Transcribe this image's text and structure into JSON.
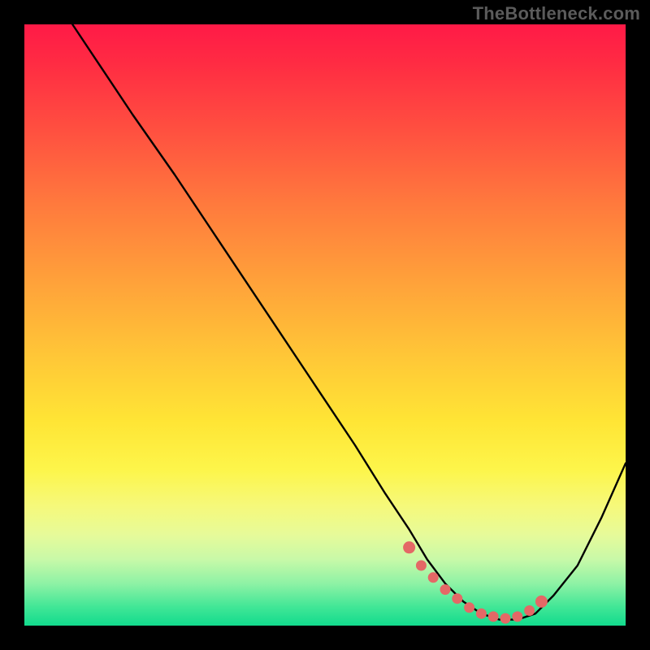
{
  "watermark": "TheBottleneck.com",
  "colors": {
    "curve": "#000000",
    "marker_fill": "#e46866",
    "marker_stroke": "#c94b49",
    "background_black": "#000000"
  },
  "chart_data": {
    "type": "line",
    "title": "",
    "xlabel": "",
    "ylabel": "",
    "xlim": [
      0,
      100
    ],
    "ylim": [
      0,
      100
    ],
    "series": [
      {
        "name": "bottleneck-curve",
        "x": [
          8,
          12,
          18,
          25,
          33,
          41,
          49,
          55,
          60,
          64,
          67,
          70,
          73,
          76,
          79,
          82,
          85,
          88,
          92,
          96,
          100
        ],
        "y": [
          100,
          94,
          85,
          75,
          63,
          51,
          39,
          30,
          22,
          16,
          11,
          7,
          4,
          2,
          1,
          1,
          2,
          5,
          10,
          18,
          27
        ]
      }
    ],
    "optimal_band": {
      "name": "optimal-markers",
      "x": [
        64,
        66,
        68,
        70,
        72,
        74,
        76,
        78,
        80,
        82,
        84,
        86
      ],
      "y": [
        13,
        10,
        8,
        6,
        4.5,
        3,
        2,
        1.5,
        1.2,
        1.5,
        2.5,
        4
      ]
    }
  }
}
